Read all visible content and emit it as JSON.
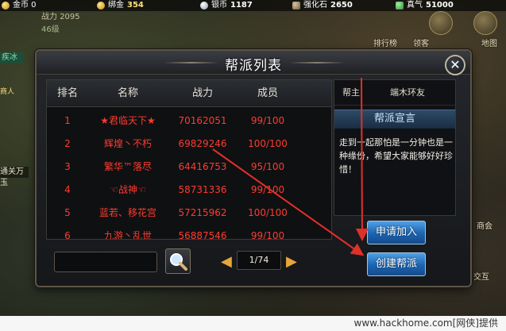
{
  "topbar": {
    "gold_label": "金币 0",
    "bound_gold_label": "绑金",
    "bound_gold_value": "354",
    "silver_label": "银币",
    "silver_value": "1187",
    "stone_label": "强化石",
    "stone_value": "2650",
    "qi_label": "真气",
    "qi_value": "51000"
  },
  "player": {
    "power_label": "战力",
    "power_value": "2095",
    "level_text": "46级"
  },
  "side": {
    "tag1": "疾冰",
    "tag2": "商人",
    "tag3": "通关万玉"
  },
  "right_menu": {
    "ranking": "排行榜",
    "third": "领客",
    "map": "地图",
    "merchant": "商会",
    "bottom": "交互"
  },
  "dialog": {
    "title": "帮派列表",
    "close_glyph": "✕",
    "columns": [
      "排名",
      "名称",
      "战力",
      "成员"
    ],
    "rows": [
      {
        "rank": "1",
        "name": "★君临天下★",
        "power": "70162051",
        "members": "99/100"
      },
      {
        "rank": "2",
        "name": "辉煌丶不朽",
        "power": "69829246",
        "members": "100/100"
      },
      {
        "rank": "3",
        "name": "繁华™落尽",
        "power": "64416753",
        "members": "95/100"
      },
      {
        "rank": "4",
        "name": "☜战神☜",
        "power": "58731336",
        "members": "99/100"
      },
      {
        "rank": "5",
        "name": "蓝若、移花宫",
        "power": "57215962",
        "members": "100/100"
      },
      {
        "rank": "6",
        "name": "九游丶乱世",
        "power": "56887546",
        "members": "99/100"
      }
    ],
    "search_placeholder": "",
    "page_indicator": "1/74",
    "prev_glyph": "◀",
    "next_glyph": "▶",
    "leader_label": "帮主",
    "leader_name": "端木环友",
    "declaration_title": "帮派宣言",
    "declaration_text": "走到一起那怕是一分钟也是一种缘份，希望大家能够好好珍惜！",
    "apply_button": "申请加入",
    "create_button": "创建帮派"
  },
  "watermark": "www.hackhome.com[网侠]提供",
  "colors": {
    "rank_text": "#ff3b2f",
    "arrow": "#e0302a",
    "button_blue": "#1c63b0"
  }
}
